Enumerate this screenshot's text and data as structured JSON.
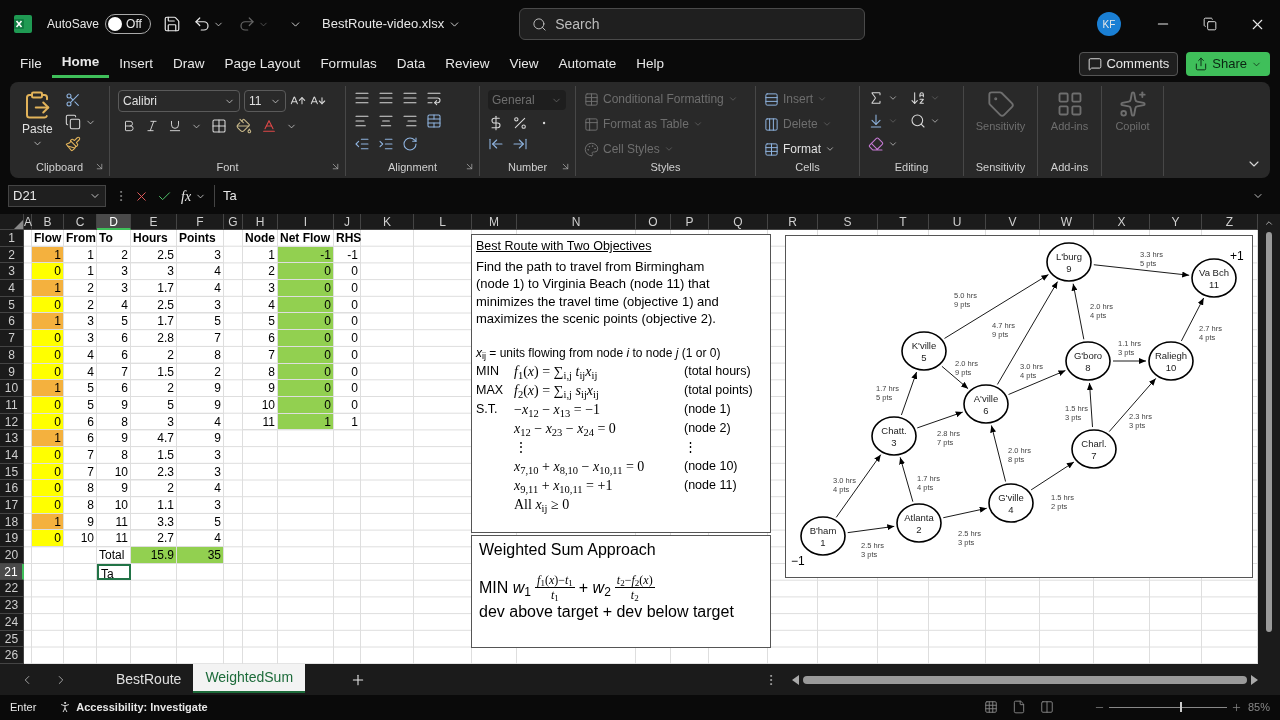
{
  "title_bar": {
    "app_label": "AutoSave",
    "autosave": {
      "on": false,
      "label": "Off"
    },
    "file_name": "BestRoute-video.xlsx",
    "search": {
      "placeholder": "Search"
    },
    "avatar": "KF"
  },
  "menu": {
    "tabs": [
      {
        "label": "File",
        "selected": false
      },
      {
        "label": "Home",
        "selected": true
      },
      {
        "label": "Insert",
        "selected": false
      },
      {
        "label": "Draw",
        "selected": false
      },
      {
        "label": "Page Layout",
        "selected": false
      },
      {
        "label": "Formulas",
        "selected": false
      },
      {
        "label": "Data",
        "selected": false
      },
      {
        "label": "Review",
        "selected": false
      },
      {
        "label": "View",
        "selected": false
      },
      {
        "label": "Automate",
        "selected": false
      },
      {
        "label": "Help",
        "selected": false
      }
    ],
    "comments": "Comments",
    "share": "Share"
  },
  "ribbon": {
    "clipboard": {
      "paste": "Paste",
      "label": "Clipboard"
    },
    "font": {
      "name": "Calibri",
      "size": "11",
      "label": "Font"
    },
    "alignment": {
      "label": "Alignment"
    },
    "number": {
      "format": {
        "value": "General",
        "disabled": true
      },
      "label": "Number"
    },
    "styles": {
      "items": [
        {
          "label": "Conditional Formatting",
          "disabled": true
        },
        {
          "label": "Format as Table",
          "disabled": true
        },
        {
          "label": "Cell Styles",
          "disabled": true
        }
      ],
      "label": "Styles"
    },
    "cells": {
      "items": [
        {
          "label": "Insert",
          "disabled": true
        },
        {
          "label": "Delete",
          "disabled": true
        },
        {
          "label": "Format",
          "disabled": false
        }
      ],
      "label": "Cells"
    },
    "editing": {
      "label": "Editing"
    },
    "sensitivity": {
      "button": "Sensitivity",
      "disabled": true,
      "label": "Sensitivity"
    },
    "addins": {
      "button": "Add-ins",
      "disabled": true,
      "label": "Add-ins"
    },
    "copilot": {
      "button": "Copilot",
      "disabled": true
    }
  },
  "formula_bar": {
    "name_box": "D21",
    "fx": "fx",
    "content": "Ta"
  },
  "sheet": {
    "columns": [
      {
        "label": "A",
        "selected": false
      },
      {
        "label": "B",
        "selected": false
      },
      {
        "label": "C",
        "selected": false
      },
      {
        "label": "D",
        "selected": true
      },
      {
        "label": "E",
        "selected": false
      },
      {
        "label": "F",
        "selected": false
      },
      {
        "label": "G",
        "selected": false
      },
      {
        "label": "H",
        "selected": false
      },
      {
        "label": "I",
        "selected": false
      },
      {
        "label": "J",
        "selected": false
      },
      {
        "label": "K",
        "selected": false
      },
      {
        "label": "L",
        "selected": false
      },
      {
        "label": "M",
        "selected": false
      },
      {
        "label": "N",
        "selected": false
      },
      {
        "label": "O",
        "selected": false
      },
      {
        "label": "P",
        "selected": false
      },
      {
        "label": "Q",
        "selected": false
      },
      {
        "label": "R",
        "selected": false
      },
      {
        "label": "S",
        "selected": false
      },
      {
        "label": "T",
        "selected": false
      },
      {
        "label": "U",
        "selected": false
      },
      {
        "label": "V",
        "selected": false
      },
      {
        "label": "W",
        "selected": false
      },
      {
        "label": "X",
        "selected": false
      },
      {
        "label": "Y",
        "selected": false
      },
      {
        "label": "Z",
        "selected": false
      }
    ],
    "rows": [
      {
        "label": "1",
        "selected": false
      },
      {
        "label": "2",
        "selected": false
      },
      {
        "label": "3",
        "selected": false
      },
      {
        "label": "4",
        "selected": false
      },
      {
        "label": "5",
        "selected": false
      },
      {
        "label": "6",
        "selected": false
      },
      {
        "label": "7",
        "selected": false
      },
      {
        "label": "8",
        "selected": false
      },
      {
        "label": "9",
        "selected": false
      },
      {
        "label": "10",
        "selected": false
      },
      {
        "label": "11",
        "selected": false
      },
      {
        "label": "12",
        "selected": false
      },
      {
        "label": "13",
        "selected": false
      },
      {
        "label": "14",
        "selected": false
      },
      {
        "label": "15",
        "selected": false
      },
      {
        "label": "16",
        "selected": false
      },
      {
        "label": "17",
        "selected": false
      },
      {
        "label": "18",
        "selected": false
      },
      {
        "label": "19",
        "selected": false
      },
      {
        "label": "20",
        "selected": false
      },
      {
        "label": "21",
        "selected": true
      },
      {
        "label": "22",
        "selected": false
      },
      {
        "label": "23",
        "selected": false
      },
      {
        "label": "24",
        "selected": false
      },
      {
        "label": "25",
        "selected": false
      },
      {
        "label": "26",
        "selected": false
      }
    ],
    "flow_table": {
      "headers": [
        "Flow",
        "From",
        "To",
        "Hours",
        "Points"
      ],
      "rows": [
        {
          "highlighted": true,
          "cells": [
            "1",
            "1",
            "2",
            "2.5",
            "3"
          ]
        },
        {
          "highlighted": false,
          "cells": [
            "0",
            "1",
            "3",
            "3",
            "4"
          ]
        },
        {
          "highlighted": true,
          "cells": [
            "1",
            "2",
            "3",
            "1.7",
            "4"
          ]
        },
        {
          "highlighted": false,
          "cells": [
            "0",
            "2",
            "4",
            "2.5",
            "3"
          ]
        },
        {
          "highlighted": true,
          "cells": [
            "1",
            "3",
            "5",
            "1.7",
            "5"
          ]
        },
        {
          "highlighted": false,
          "cells": [
            "0",
            "3",
            "6",
            "2.8",
            "7"
          ]
        },
        {
          "highlighted": false,
          "cells": [
            "0",
            "4",
            "6",
            "2",
            "8"
          ]
        },
        {
          "highlighted": false,
          "cells": [
            "0",
            "4",
            "7",
            "1.5",
            "2"
          ]
        },
        {
          "highlighted": true,
          "cells": [
            "1",
            "5",
            "6",
            "2",
            "9"
          ]
        },
        {
          "highlighted": false,
          "cells": [
            "0",
            "5",
            "9",
            "5",
            "9"
          ]
        },
        {
          "highlighted": false,
          "cells": [
            "0",
            "6",
            "8",
            "3",
            "4"
          ]
        },
        {
          "highlighted": true,
          "cells": [
            "1",
            "6",
            "9",
            "4.7",
            "9"
          ]
        },
        {
          "highlighted": false,
          "cells": [
            "0",
            "7",
            "8",
            "1.5",
            "3"
          ]
        },
        {
          "highlighted": false,
          "cells": [
            "0",
            "7",
            "10",
            "2.3",
            "3"
          ]
        },
        {
          "highlighted": false,
          "cells": [
            "0",
            "8",
            "9",
            "2",
            "4"
          ]
        },
        {
          "highlighted": false,
          "cells": [
            "0",
            "8",
            "10",
            "1.1",
            "3"
          ]
        },
        {
          "highlighted": true,
          "cells": [
            "1",
            "9",
            "11",
            "3.3",
            "5"
          ]
        },
        {
          "highlighted": false,
          "cells": [
            "0",
            "10",
            "11",
            "2.7",
            "4"
          ]
        }
      ],
      "total": {
        "label": "Total",
        "hours": "15.9",
        "points": "35"
      }
    },
    "node_table": {
      "headers": [
        "Node",
        "Net Flow",
        "RHS"
      ],
      "rows": [
        [
          "1",
          "-1",
          "-1"
        ],
        [
          "2",
          "0",
          "0"
        ],
        [
          "3",
          "0",
          "0"
        ],
        [
          "4",
          "0",
          "0"
        ],
        [
          "5",
          "0",
          "0"
        ],
        [
          "6",
          "0",
          "0"
        ],
        [
          "7",
          "0",
          "0"
        ],
        [
          "8",
          "0",
          "0"
        ],
        [
          "9",
          "0",
          "0"
        ],
        [
          "10",
          "0",
          "0"
        ],
        [
          "11",
          "1",
          "1"
        ]
      ]
    },
    "active_cell": {
      "value": "Ta"
    }
  },
  "problem_box": {
    "title": "Best Route with Two Objectives",
    "description": "Find the path to travel from Birmingham (node 1) to Virginia Beach (node 11) that minimizes the travel time (objective 1) and maximizes the scenic points (objective 2).",
    "definition": "*x*$_{ij}$ = units flowing from node *i* to node *j* (1 or 0)",
    "lines": [
      {
        "label": "MIN",
        "expr": "*f*$_{1}$(*x*) = ∑$_{i,j}$ *t*$_{ij}$*x*$_{ij}$",
        "note": "(total hours)"
      },
      {
        "label": "MAX",
        "expr": "*f*$_{2}$(*x*) = ∑$_{i,j}$ *s*$_{ij}$*x*$_{ij}$",
        "note": "(total points)"
      },
      {
        "label": "S.T.",
        "expr": "−*x*$_{12}$ − *x*$_{13}$ = −1",
        "note": "(node 1)"
      },
      {
        "expr": "*x*$_{12}$ − *x*$_{23}$ − *x*$_{24}$ = 0",
        "note": "(node 2)"
      },
      {
        "expr": "⋮",
        "note": "⋮"
      },
      {
        "expr": "*x*$_{7,10}$ + *x*$_{8,10}$ − *x*$_{10,11}$ = 0",
        "note": "(node 10)"
      },
      {
        "expr": "*x*$_{9,11}$ + *x*$_{10,11}$ = +1",
        "note": "(node 11)"
      },
      {
        "expr": "All *x*$_{ij}$ ≥ 0"
      }
    ]
  },
  "weighted_box": {
    "title": "Weighted Sum Approach",
    "lead": "MIN *w*$_{1}$",
    "fraction_1": {
      "numerator": "*f*$_{1}$(*x*)−*t*$_{1}$",
      "denominator": "*t*$_{1}$"
    },
    "mid": "+ *w*$_{2}$",
    "fraction_2": {
      "numerator": "*t*$_{2}$−*f*$_{2}$(*x*)",
      "denominator": "*t*$_{2}$"
    },
    "caption": "dev above target + dev below target"
  },
  "network": {
    "nodes": [
      {
        "name": "B'ham",
        "number": "1"
      },
      {
        "name": "Atlanta",
        "number": "2"
      },
      {
        "name": "Chatt.",
        "number": "3"
      },
      {
        "name": "G'ville",
        "number": "4"
      },
      {
        "name": "K'ville",
        "number": "5"
      },
      {
        "name": "A'ville",
        "number": "6"
      },
      {
        "name": "Charl.",
        "number": "7"
      },
      {
        "name": "G'boro",
        "number": "8"
      },
      {
        "name": "L'burg",
        "number": "9"
      },
      {
        "name": "Raliegh",
        "number": "10"
      },
      {
        "name": "Va Bch",
        "number": "11"
      }
    ],
    "edges": [
      {
        "hours": "3.0 hrs",
        "points": "4 pts"
      },
      {
        "hours": "2.5 hrs",
        "points": "3 pts"
      },
      {
        "hours": "1.7 hrs",
        "points": "4 pts"
      },
      {
        "hours": "2.5 hrs",
        "points": "3 pts"
      },
      {
        "hours": "1.7 hrs",
        "points": "5 pts"
      },
      {
        "hours": "2.8 hrs",
        "points": "7 pts"
      },
      {
        "hours": "2.0 hrs",
        "points": "8 pts"
      },
      {
        "hours": "1.5 hrs",
        "points": "2 pts"
      },
      {
        "hours": "5.0 hrs",
        "points": "9 pts"
      },
      {
        "hours": "2.0 hrs",
        "points": "9 pts"
      },
      {
        "hours": "4.7 hrs",
        "points": "9 pts"
      },
      {
        "hours": "3.0 hrs",
        "points": "4 pts"
      },
      {
        "hours": "1.5 hrs",
        "points": "3 pts"
      },
      {
        "hours": "2.3 hrs",
        "points": "3 pts"
      },
      {
        "hours": "2.0 hrs",
        "points": "4 pts"
      },
      {
        "hours": "1.1 hrs",
        "points": "3 pts"
      },
      {
        "hours": "3.3 hrs",
        "points": "5 pts"
      },
      {
        "hours": "2.7 hrs",
        "points": "4 pts"
      }
    ],
    "source_label": "−1",
    "sink_label": "+1"
  },
  "sheet_tabs": [
    {
      "label": "BestRoute",
      "selected": false
    },
    {
      "label": "WeightedSum",
      "selected": true
    }
  ],
  "status_bar": {
    "mode": "Enter",
    "accessibility": "Accessibility: Investigate",
    "zoom": {
      "level": 0.6,
      "label": "85%"
    }
  }
}
